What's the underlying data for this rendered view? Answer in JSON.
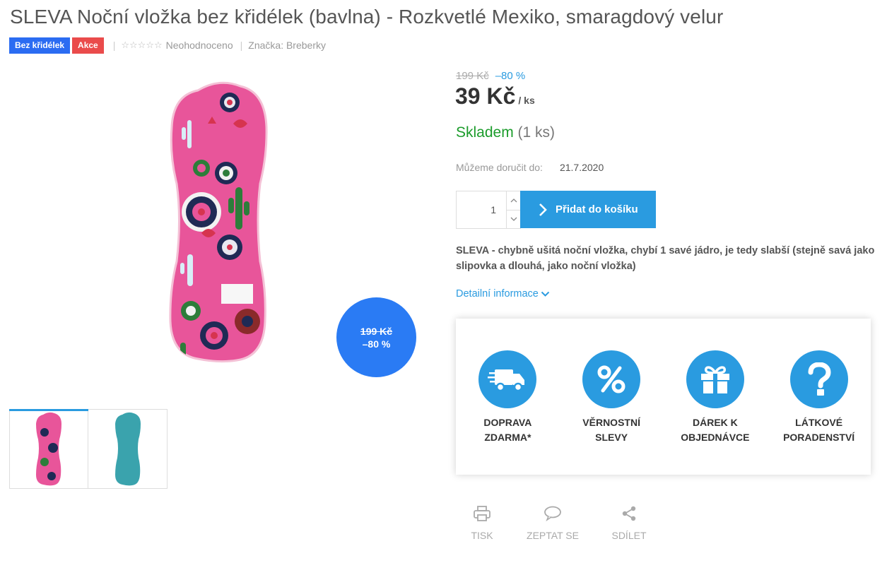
{
  "product": {
    "title": "SLEVA Noční vložka bez křidélek (bavlna) - Rozkvetlé Mexiko, smaragdový velur",
    "tags": [
      "Bez křidélek",
      "Akce"
    ],
    "rating_text": "Neohodnoceno",
    "brand": "Značka: Breberky"
  },
  "badge": {
    "old_price": "199 Kč",
    "discount": "–80 %"
  },
  "pricing": {
    "old_price": "199 Kč",
    "discount": "–80 %",
    "price": "39 Kč",
    "unit": "/ ks"
  },
  "stock": {
    "status": "Skladem",
    "qty": "(1 ks)"
  },
  "delivery": {
    "label": "Můžeme doručit do:",
    "date": "21.7.2020"
  },
  "cart": {
    "quantity": "1",
    "add_label": "Přidat do košíku"
  },
  "description": "SLEVA - chybně ušitá noční vložka, chybí 1 savé jádro, je tedy slabší (stejně savá jako slipovka a dlouhá, jako noční vložka)",
  "detail_link": "Detailní informace",
  "benefits": [
    {
      "icon": "truck-icon",
      "label": "DOPRAVA ZDARMA*"
    },
    {
      "icon": "percent-icon",
      "label": "VĚRNOSTNÍ SLEVY"
    },
    {
      "icon": "gift-icon",
      "label": "DÁREK K OBJEDNÁVCE"
    },
    {
      "icon": "question-icon",
      "label": "LÁTKOVÉ PORADENSTVÍ"
    }
  ],
  "actions": [
    {
      "icon": "print-icon",
      "label": "TISK"
    },
    {
      "icon": "chat-icon",
      "label": "ZEPTAT SE"
    },
    {
      "icon": "share-icon",
      "label": "SDÍLET"
    }
  ],
  "colors": {
    "accent": "#2a9be0",
    "badge_blue": "#2a7bf4",
    "tag_blue": "#2b6cf2",
    "tag_red": "#ea4b4b",
    "stock_green": "#1b9c2b",
    "pad_pink": "#e8559a",
    "pad_teal": "#3aa3ad"
  }
}
